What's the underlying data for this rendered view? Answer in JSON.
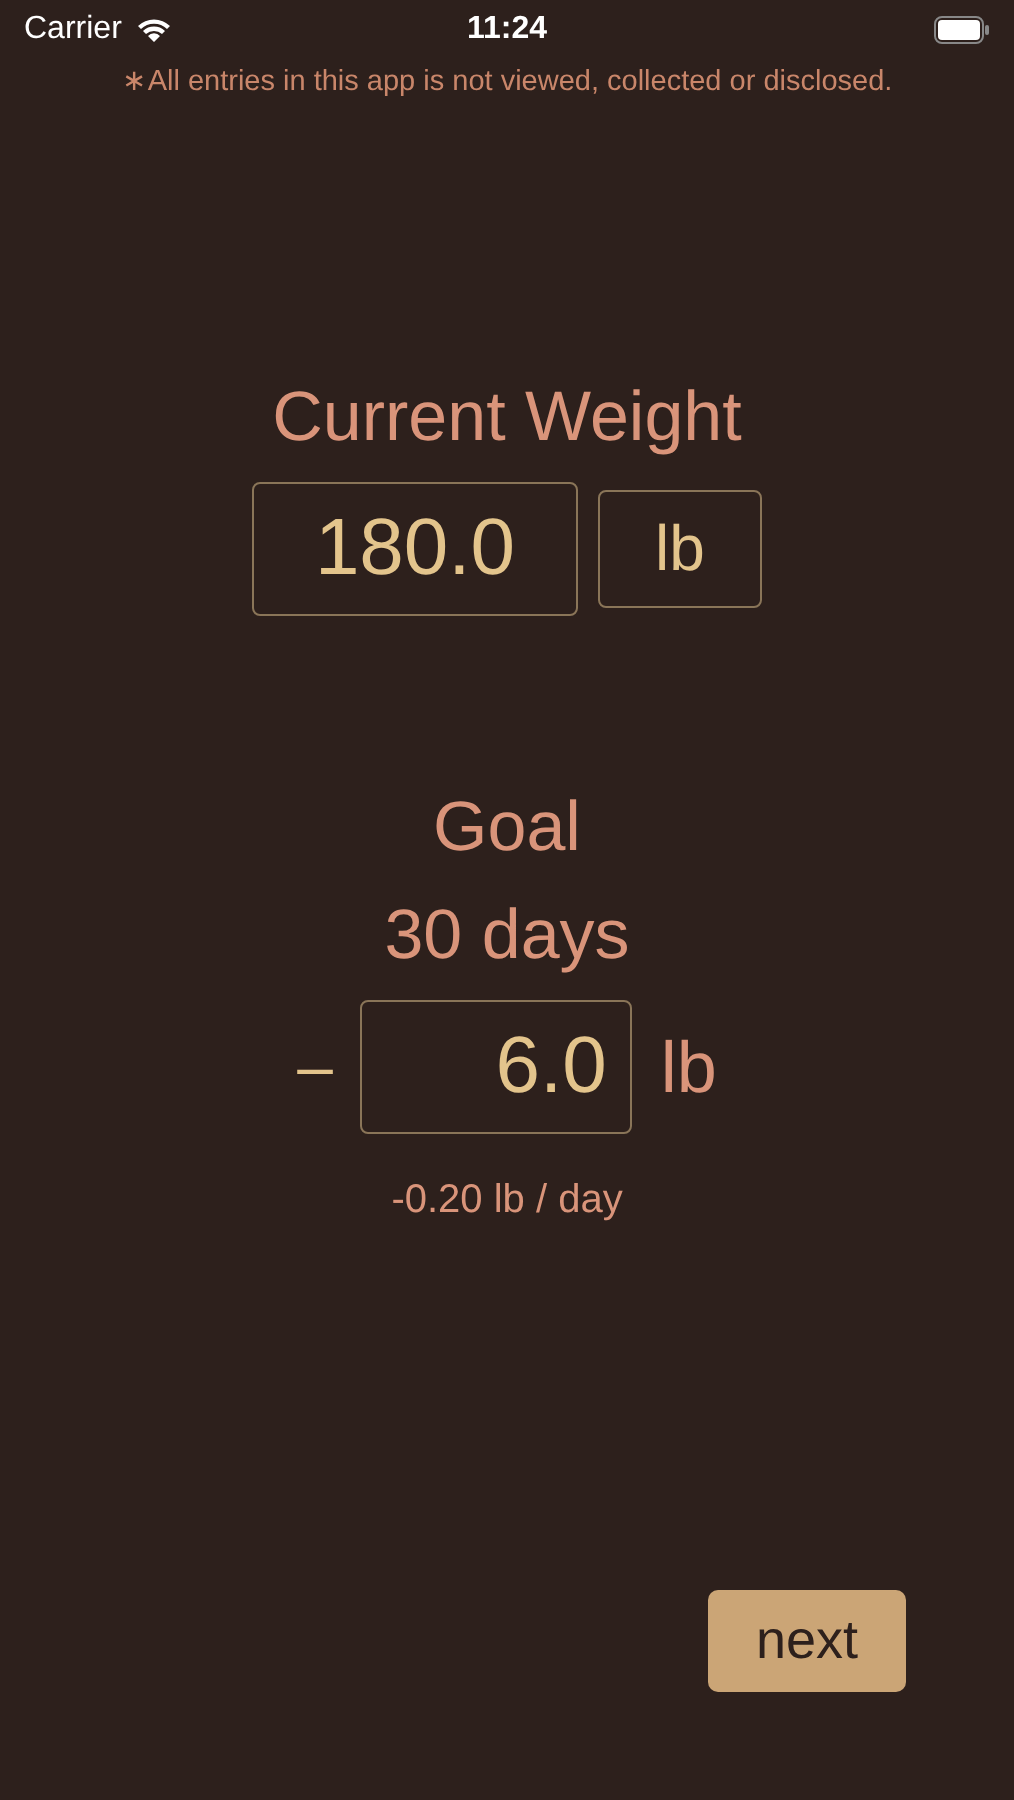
{
  "status_bar": {
    "carrier": "Carrier",
    "time": "11:24"
  },
  "notice": "∗All entries in this app is not viewed, collected or disclosed.",
  "current_weight": {
    "title": "Current Weight",
    "value": "180.0",
    "unit": "lb"
  },
  "goal": {
    "title": "Goal",
    "period": "30 days",
    "sign": "–",
    "value": "6.0",
    "unit": "lb",
    "rate": "-0.20 lb / day"
  },
  "next_button": "next"
}
